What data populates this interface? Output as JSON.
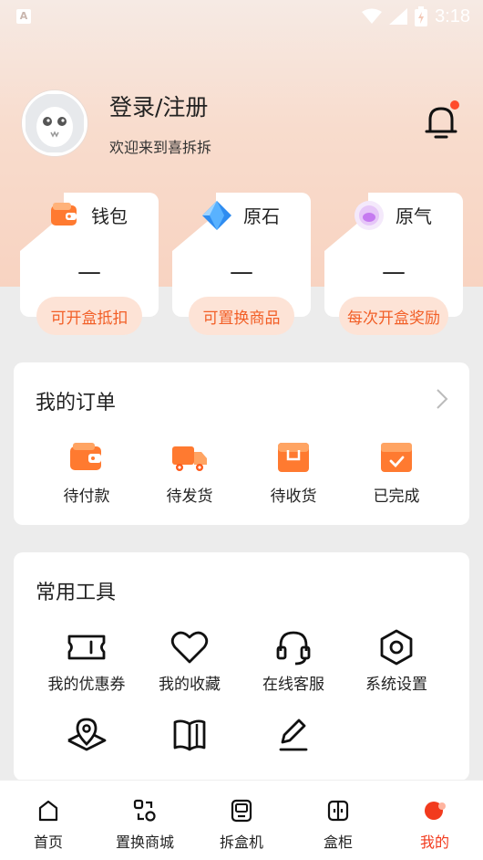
{
  "status_bar": {
    "time": "3:18",
    "left_icon": "A"
  },
  "profile": {
    "title": "登录/注册",
    "subtitle": "欢迎来到喜拆拆"
  },
  "wallets": [
    {
      "label": "钱包",
      "value": "—",
      "tag": "可开盒抵扣",
      "icon": "wallet-icon"
    },
    {
      "label": "原石",
      "value": "—",
      "tag": "可置换商品",
      "icon": "gem-icon"
    },
    {
      "label": "原气",
      "value": "—",
      "tag": "每次开盒奖励",
      "icon": "energy-orb-icon"
    }
  ],
  "orders": {
    "title": "我的订单",
    "items": [
      {
        "label": "待付款",
        "icon": "wallet-icon"
      },
      {
        "label": "待发货",
        "icon": "truck-icon"
      },
      {
        "label": "待收货",
        "icon": "box-icon"
      },
      {
        "label": "已完成",
        "icon": "check-box-icon"
      }
    ]
  },
  "tools": {
    "title": "常用工具",
    "items": [
      {
        "label": "我的优惠券",
        "icon": "coupon-icon"
      },
      {
        "label": "我的收藏",
        "icon": "heart-icon"
      },
      {
        "label": "在线客服",
        "icon": "headset-icon"
      },
      {
        "label": "系统设置",
        "icon": "settings-icon"
      }
    ],
    "extra_icons": [
      "location-icon",
      "book-icon",
      "edit-icon"
    ]
  },
  "tabbar": {
    "items": [
      {
        "label": "首页",
        "icon": "home-icon"
      },
      {
        "label": "置换商城",
        "icon": "exchange-icon"
      },
      {
        "label": "拆盒机",
        "icon": "machine-icon"
      },
      {
        "label": "盒柜",
        "icon": "cabinet-icon"
      },
      {
        "label": "我的",
        "icon": "profile-dot-icon"
      }
    ],
    "active_index": 4
  },
  "colors": {
    "accent": "#f25f27",
    "tag_bg": "#fde3d6",
    "active_tab": "#f23a1d",
    "notification_dot": "#ff4b2b"
  }
}
